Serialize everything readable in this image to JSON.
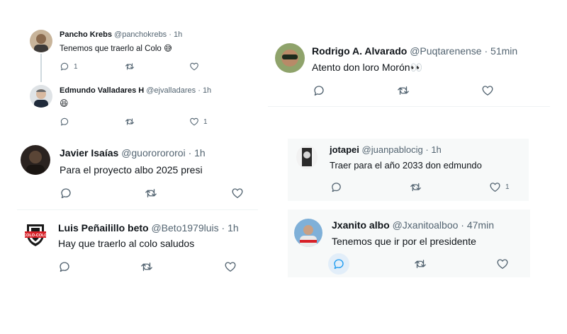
{
  "tweets": {
    "pancho": {
      "name": "Pancho Krebs",
      "handle": "@panchokrebs",
      "sep": "·",
      "time": "1h",
      "text": "Tenemos que traerlo al Colo 😅",
      "replies": "1",
      "retweets": "",
      "likes": ""
    },
    "edmundo": {
      "name": "Edmundo Valladares H",
      "handle": "@ejvalladares",
      "sep": "·",
      "time": "1h",
      "text": "😆",
      "replies": "",
      "retweets": "",
      "likes": "1"
    },
    "javier": {
      "name": "Javier Isaías",
      "handle": "@guororororoi",
      "sep": "·",
      "time": "1h",
      "text": "Para el proyecto albo 2025 presi",
      "replies": "",
      "retweets": "",
      "likes": ""
    },
    "luis": {
      "name": "Luis Peñailillo beto",
      "handle": "@Beto1979luis",
      "sep": "·",
      "time": "1h",
      "text": "Hay que traerlo al colo saludos",
      "replies": "",
      "retweets": "",
      "likes": "",
      "avatar_text": "COLO-COLO"
    },
    "rodrigo": {
      "name": "Rodrigo A. Alvarado",
      "handle": "@Puqtarenense",
      "sep": "·",
      "time": "51min",
      "text": "Atento don loro Morón👀",
      "replies": "",
      "retweets": "",
      "likes": ""
    },
    "jotapei": {
      "name": "jotapei",
      "handle": "@juanpablocig",
      "sep": "·",
      "time": "1h",
      "text": "Traer para el año 2033 don edmundo",
      "replies": "",
      "retweets": "",
      "likes": "1"
    },
    "jxanito": {
      "name": "Jxanito albo",
      "handle": "@Jxanitoalboo",
      "sep": "·",
      "time": "47min",
      "text": "Tenemos que ir por el presidente",
      "replies": "",
      "retweets": "",
      "likes": ""
    }
  },
  "icons": {
    "reply": "reply-icon",
    "retweet": "retweet-icon",
    "like": "heart-icon"
  },
  "colors": {
    "text": "#0f1419",
    "muted": "#536471",
    "accent": "#1d9bf0",
    "shaded_bg": "#f7f9f9"
  }
}
